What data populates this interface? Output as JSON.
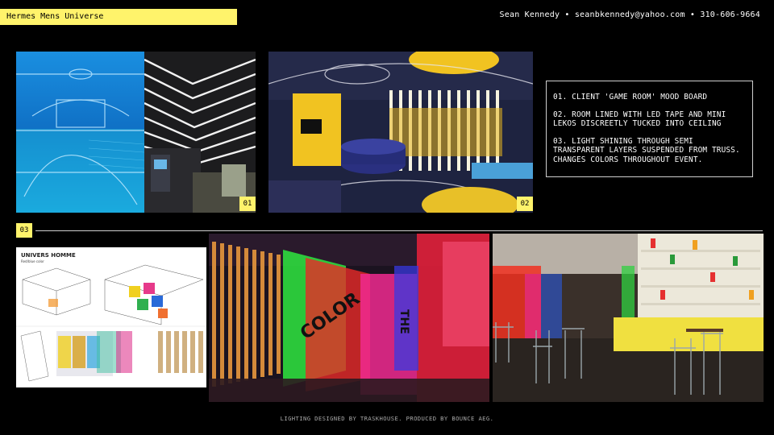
{
  "header": {
    "title": "Hermes Mens Universe",
    "contact": "Sean Kennedy • seanbkennedy@yahoo.com • 310-606-9664"
  },
  "badges": {
    "b1": "01",
    "b2": "02",
    "b3": "03"
  },
  "notes": [
    "01. CLIENT 'GAME ROOM' MOOD BOARD",
    "02. ROOM LINED WITH LED TAPE AND MINI LEKOS DISCREETLY TUCKED INTO CEILING",
    "03. LIGHT SHINING THROUGH SEMI TRANSPARENT LAYERS SUSPENDED FROM TRUSS. CHANGES COLORS THROUGHOUT EVENT."
  ],
  "sketch": {
    "title": "UNIVERS HOMME",
    "subtitle": "Red/blue color"
  },
  "photo_text": {
    "color_word": "COLOR",
    "the_word": "THE"
  },
  "footer": "LIGHTING DESIGNED BY TRASKHOUSE. PRODUCED BY BOUNCE AEG.",
  "colors": {
    "accent_yellow": "#fff36b",
    "background": "#000000",
    "rule": "#cfcfcf"
  }
}
